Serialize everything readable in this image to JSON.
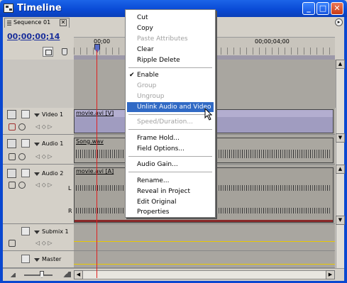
{
  "window": {
    "title": "Timeline",
    "minimize": "_",
    "maximize": "□",
    "close": "✕"
  },
  "tab": {
    "label": "Sequence 01",
    "close": "✕",
    "menu": "▸"
  },
  "timecode": "00;00;00;14",
  "ruler": {
    "start": "00;00",
    "mark": "00;00;04;00"
  },
  "tracks": {
    "video1": {
      "name": "Video 1",
      "clip": "movie.avi [V]"
    },
    "audio1": {
      "name": "Audio 1",
      "clip": "Song.wav"
    },
    "audio2": {
      "name": "Audio 2",
      "clip": "movie.avi [A]",
      "ch_l": "L",
      "ch_r": "R"
    },
    "submix1": {
      "name": "Submix 1"
    },
    "master": {
      "name": "Master"
    }
  },
  "context_menu": {
    "items": [
      {
        "label": "Cut",
        "enabled": true
      },
      {
        "label": "Copy",
        "enabled": true
      },
      {
        "label": "Paste Attributes",
        "enabled": false
      },
      {
        "label": "Clear",
        "enabled": true
      },
      {
        "label": "Ripple Delete",
        "enabled": true
      },
      {
        "label": "Enable",
        "enabled": true,
        "checked": true
      },
      {
        "label": "Group",
        "enabled": false
      },
      {
        "label": "Ungroup",
        "enabled": false
      },
      {
        "label": "Unlink Audio and Video",
        "enabled": true,
        "highlighted": true
      },
      {
        "label": "Speed/Duration...",
        "enabled": false
      },
      {
        "label": "Frame Hold...",
        "enabled": true
      },
      {
        "label": "Field Options...",
        "enabled": true
      },
      {
        "label": "Audio Gain...",
        "enabled": true
      },
      {
        "label": "Rename...",
        "enabled": true
      },
      {
        "label": "Reveal in Project",
        "enabled": true
      },
      {
        "label": "Edit Original",
        "enabled": true
      },
      {
        "label": "Properties",
        "enabled": true
      }
    ],
    "check_glyph": "✔"
  },
  "colors": {
    "title_bar": "#0a4bd6",
    "menu_highlight": "#316ac5",
    "playhead": "#e02020",
    "video_clip": "#b3aed0"
  }
}
